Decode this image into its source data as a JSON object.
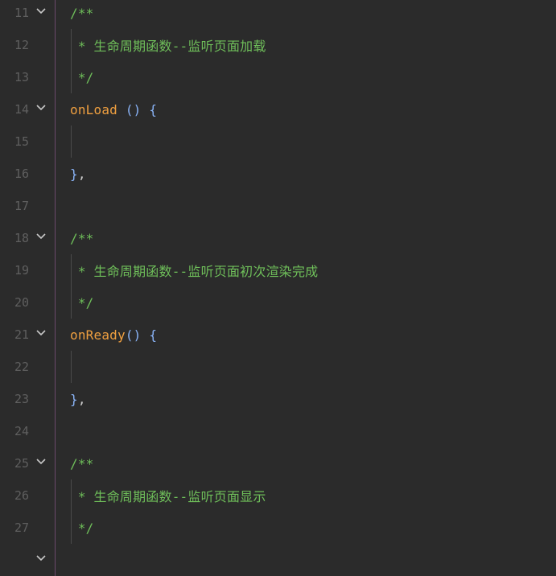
{
  "editor": {
    "lines": [
      {
        "no": "11",
        "fold": true,
        "guide": false,
        "tokens": [
          {
            "cls": "c-comment",
            "text": "/**"
          }
        ]
      },
      {
        "no": "12",
        "fold": false,
        "guide": true,
        "tokens": [
          {
            "cls": "c-comment",
            "text": " * 生命周期函数--监听页面加载"
          }
        ]
      },
      {
        "no": "13",
        "fold": false,
        "guide": true,
        "tokens": [
          {
            "cls": "c-comment",
            "text": " */"
          }
        ]
      },
      {
        "no": "14",
        "fold": true,
        "guide": false,
        "tokens": [
          {
            "cls": "c-fn",
            "text": "onLoad"
          },
          {
            "cls": "c-punc",
            "text": " () "
          },
          {
            "cls": "c-brace",
            "text": "{"
          }
        ]
      },
      {
        "no": "15",
        "fold": false,
        "guide": true,
        "tokens": []
      },
      {
        "no": "16",
        "fold": false,
        "guide": false,
        "tokens": [
          {
            "cls": "c-brace",
            "text": "}"
          },
          {
            "cls": "c-comma",
            "text": ","
          }
        ]
      },
      {
        "no": "17",
        "fold": false,
        "guide": false,
        "tokens": []
      },
      {
        "no": "18",
        "fold": true,
        "guide": false,
        "tokens": [
          {
            "cls": "c-comment",
            "text": "/**"
          }
        ]
      },
      {
        "no": "19",
        "fold": false,
        "guide": true,
        "tokens": [
          {
            "cls": "c-comment",
            "text": " * 生命周期函数--监听页面初次渲染完成"
          }
        ]
      },
      {
        "no": "20",
        "fold": false,
        "guide": true,
        "tokens": [
          {
            "cls": "c-comment",
            "text": " */"
          }
        ]
      },
      {
        "no": "21",
        "fold": true,
        "guide": false,
        "tokens": [
          {
            "cls": "c-fn",
            "text": "onReady"
          },
          {
            "cls": "c-punc",
            "text": "() "
          },
          {
            "cls": "c-brace",
            "text": "{"
          }
        ]
      },
      {
        "no": "22",
        "fold": false,
        "guide": true,
        "tokens": []
      },
      {
        "no": "23",
        "fold": false,
        "guide": false,
        "tokens": [
          {
            "cls": "c-brace",
            "text": "}"
          },
          {
            "cls": "c-comma",
            "text": ","
          }
        ]
      },
      {
        "no": "24",
        "fold": false,
        "guide": false,
        "tokens": []
      },
      {
        "no": "25",
        "fold": true,
        "guide": false,
        "tokens": [
          {
            "cls": "c-comment",
            "text": "/**"
          }
        ]
      },
      {
        "no": "26",
        "fold": false,
        "guide": true,
        "tokens": [
          {
            "cls": "c-comment",
            "text": " * 生命周期函数--监听页面显示"
          }
        ]
      },
      {
        "no": "27",
        "fold": false,
        "guide": true,
        "tokens": [
          {
            "cls": "c-comment",
            "text": " */"
          }
        ]
      },
      {
        "no": "",
        "fold": true,
        "guide": false,
        "tokens": []
      }
    ]
  },
  "colors": {
    "background": "#2b2b2b",
    "line_number": "#5f5f5f",
    "comment": "#6fbf5a",
    "function_name": "#f0a040",
    "punctuation": "#8ab4f8"
  }
}
